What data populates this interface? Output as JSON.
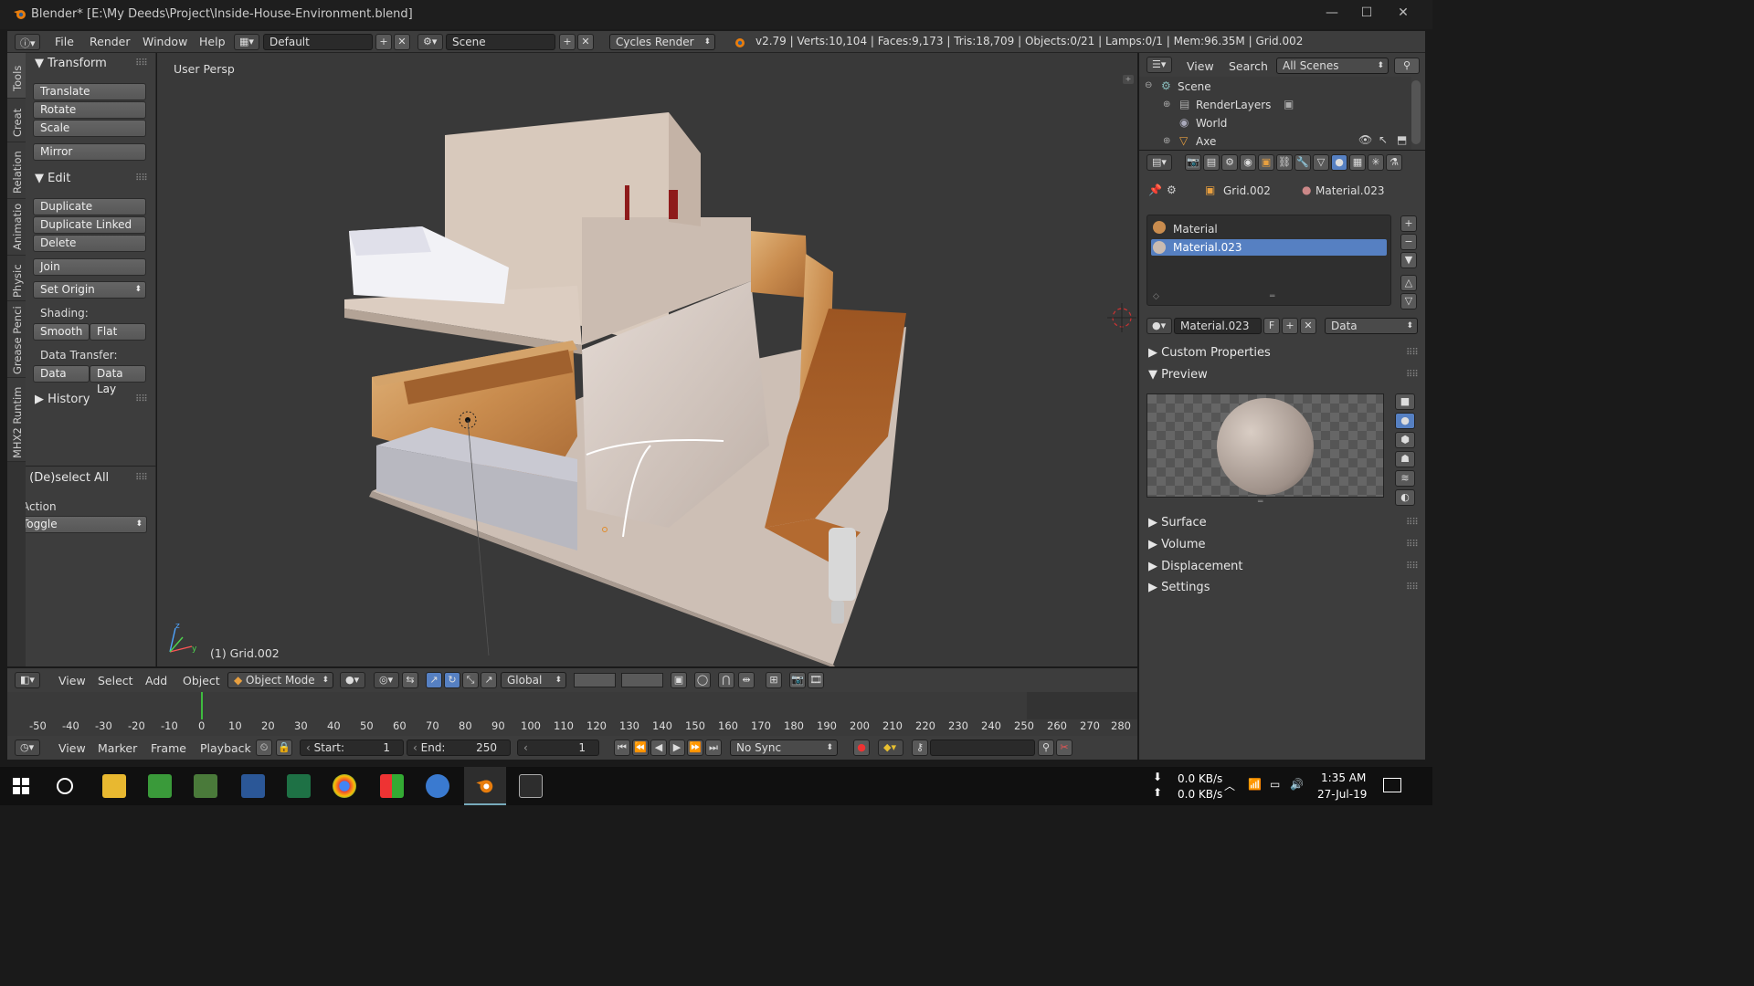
{
  "window": {
    "title": "Blender* [E:\\My Deeds\\Project\\Inside-House-Environment.blend]"
  },
  "info_header": {
    "menus": [
      "File",
      "Render",
      "Window",
      "Help"
    ],
    "layout": "Default",
    "scene": "Scene",
    "engine": "Cycles Render",
    "stats": "v2.79 | Verts:10,104 | Faces:9,173 | Tris:18,709 | Objects:0/21 | Lamps:0/1 | Mem:96.35M | Grid.002"
  },
  "tool_tabs": [
    "Tools",
    "Creat",
    "Relation",
    "Animatio",
    "Physic",
    "Grease Penci",
    "MHX2 Runtim"
  ],
  "tool_shelf": {
    "transform": {
      "title": "Transform",
      "buttons": [
        "Translate",
        "Rotate",
        "Scale",
        "Mirror"
      ]
    },
    "edit": {
      "title": "Edit",
      "buttons": [
        "Duplicate",
        "Duplicate Linked",
        "Delete",
        "Join",
        "Set Origin"
      ],
      "shading_label": "Shading:",
      "smooth": "Smooth",
      "flat": "Flat",
      "data_transfer_label": "Data Transfer:",
      "data": "Data",
      "data_lay": "Data Lay"
    },
    "history": "History",
    "deselect": {
      "title": "(De)select All",
      "action_label": "Action",
      "action_value": "Toggle"
    }
  },
  "viewport": {
    "view_label": "User Persp",
    "object_label": "(1) Grid.002"
  },
  "viewport_header": {
    "menus": [
      "View",
      "Select",
      "Add",
      "Object"
    ],
    "mode": "Object Mode",
    "orientation": "Global"
  },
  "timeline": {
    "ticks": [
      "-50",
      "-40",
      "-30",
      "-20",
      "-10",
      "0",
      "10",
      "20",
      "30",
      "40",
      "50",
      "60",
      "70",
      "80",
      "90",
      "100",
      "110",
      "120",
      "130",
      "140",
      "150",
      "160",
      "170",
      "180",
      "190",
      "200",
      "210",
      "220",
      "230",
      "240",
      "250",
      "260",
      "270",
      "280"
    ],
    "menus": [
      "View",
      "Marker",
      "Frame",
      "Playback"
    ],
    "start_label": "Start:",
    "start_value": "1",
    "end_label": "End:",
    "end_value": "250",
    "current_frame": "1",
    "sync": "No Sync"
  },
  "outliner": {
    "menus": [
      "View",
      "Search"
    ],
    "filter": "All Scenes",
    "items": [
      "Scene",
      "RenderLayers",
      "World",
      "Axe"
    ]
  },
  "properties": {
    "breadcrumb_object": "Grid.002",
    "breadcrumb_material": "Material.023",
    "material_slots": [
      "Material",
      "Material.023"
    ],
    "material_name": "Material.023",
    "fake_user": "F",
    "link": "Data",
    "panels": {
      "custom_props": "Custom Properties",
      "preview": "Preview",
      "surface": "Surface",
      "volume": "Volume",
      "displacement": "Displacement",
      "settings": "Settings"
    }
  },
  "taskbar": {
    "net_down": "0.0 KB/s",
    "net_up": "0.0 KB/s",
    "time": "1:35 AM",
    "date": "27-Jul-19"
  }
}
